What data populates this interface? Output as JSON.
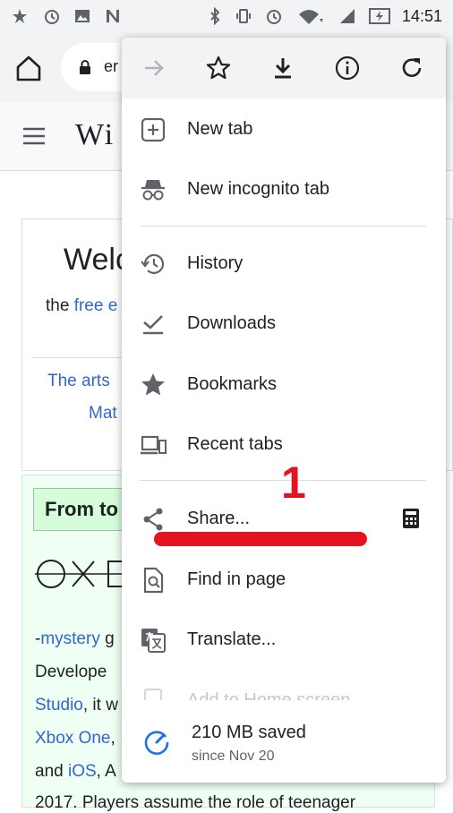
{
  "status_bar": {
    "time": "14:51",
    "left_icons": [
      "data-saver-icon",
      "alarm-icon",
      "image-icon",
      "n-app-icon"
    ],
    "right_icons": [
      "bluetooth-icon",
      "vibrate-icon",
      "alarm-icon",
      "wifi-icon",
      "signal-icon",
      "battery-charging-icon"
    ]
  },
  "toolbar": {
    "url": "er",
    "home_icon": "home-icon",
    "lock_icon": "lock-icon"
  },
  "page": {
    "logo": "Wi",
    "welcome": "Welc",
    "free_prefix": "the",
    "free_link": "free e",
    "arts": "The arts",
    "math": "Mat",
    "tfa_title": "From to",
    "lines": [
      {
        "pre": "-",
        "link": "mystery",
        "post": " g"
      },
      {
        "pre": "Develope",
        "link": "",
        "post": ""
      },
      {
        "pre": "",
        "link": "Studio",
        "post": ", it w"
      },
      {
        "pre": "",
        "link": "Xbox One",
        "post": ","
      },
      {
        "pre": "and ",
        "link": "iOS",
        "post": ", A"
      },
      {
        "pre": "2017. Players assume the role of teenager",
        "link": "",
        "post": ""
      }
    ]
  },
  "menu": {
    "top_icons": [
      "forward-icon",
      "bookmark-star-icon",
      "download-icon",
      "info-icon",
      "refresh-icon"
    ],
    "items": [
      {
        "label": "New tab",
        "icon": "new-tab-icon"
      },
      {
        "label": "New incognito tab",
        "icon": "incognito-icon"
      },
      {
        "label": "History",
        "icon": "history-icon"
      },
      {
        "label": "Downloads",
        "icon": "downloads-check-icon"
      },
      {
        "label": "Bookmarks",
        "icon": "star-icon"
      },
      {
        "label": "Recent tabs",
        "icon": "devices-icon"
      },
      {
        "label": "Share...",
        "icon": "share-icon"
      },
      {
        "label": "Find in page",
        "icon": "find-in-page-icon"
      },
      {
        "label": "Translate...",
        "icon": "translate-icon"
      },
      {
        "label": "Add to Home screen",
        "icon": "add-to-home-icon"
      }
    ],
    "share_side_icon": "calculator-icon",
    "savings": {
      "title": "210 MB saved",
      "subtitle": "since Nov 20",
      "icon": "data-saver-gauge-icon"
    }
  },
  "annotation": {
    "step_number": "1",
    "color": "#e3141f"
  }
}
